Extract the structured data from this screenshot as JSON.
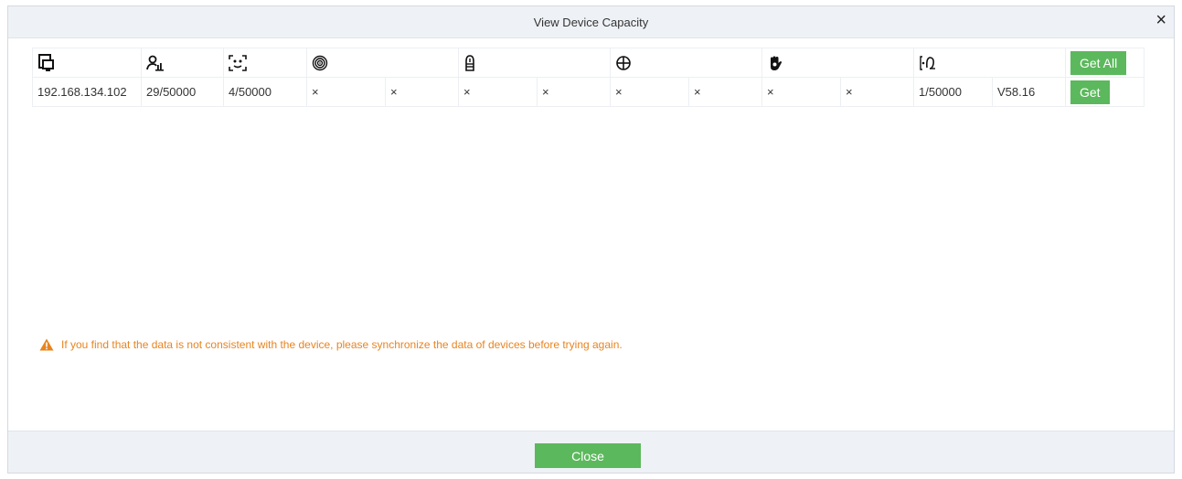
{
  "dialog": {
    "title": "View Device Capacity",
    "close_glyph": "×"
  },
  "table": {
    "header_icons": [
      "device-icon",
      "user-icon",
      "face-icon",
      "fingerprint-icon",
      "finger-vein-icon",
      "palm-icon",
      "hand-icon",
      "photo-icon"
    ],
    "get_all_label": "Get All",
    "row": {
      "ip": "192.168.134.102",
      "users": "29/50000",
      "faces": "4/50000",
      "fingerprint_count": "×",
      "fingerprint_version": "×",
      "finger_vein_count": "×",
      "finger_vein_version": "×",
      "palm_count": "×",
      "palm_version": "×",
      "hand_count": "×",
      "hand_version": "×",
      "photo_count": "1/50000",
      "photo_version": "V58.16",
      "get_label": "Get"
    }
  },
  "warning": {
    "text": "If you find that the data is not consistent with the device, please synchronize the data of devices before trying again.",
    "color": "#e8841f"
  },
  "footer": {
    "close_label": "Close"
  },
  "colors": {
    "accent_green": "#5cb85c",
    "bar_bg": "#eef2f6"
  }
}
